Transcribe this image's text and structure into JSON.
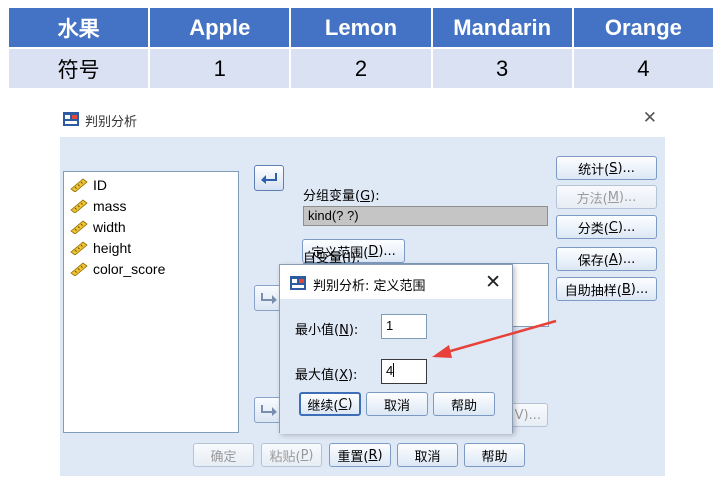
{
  "fruit_table": {
    "headers": [
      "水果",
      "Apple",
      "Lemon",
      "Mandarin",
      "Orange"
    ],
    "values": [
      "符号",
      "1",
      "2",
      "3",
      "4"
    ]
  },
  "main_dialog": {
    "title": "判别分析",
    "close_glyph": "✕",
    "variables": [
      "ID",
      "mass",
      "width",
      "height",
      "color_score"
    ],
    "grouping_label_text": "分组变量(",
    "grouping_label_key": "G",
    "grouping_label_end": "):",
    "grouping_value": "kind(? ?)",
    "define_range_text": "定义范围(",
    "define_range_key": "D",
    "define_range_end": ")...",
    "independents_label_text": "自变量(",
    "independents_label_key": "I",
    "independents_label_end": "):",
    "hidden_button_tail": "V)...",
    "right_buttons": [
      {
        "text": "统计(",
        "key": "S",
        "end": ")..."
      },
      {
        "text": "方法(",
        "key": "M",
        "end": ")..."
      },
      {
        "text": "分类(",
        "key": "C",
        "end": ")..."
      },
      {
        "text": "保存(",
        "key": "A",
        "end": ")..."
      },
      {
        "text": "自助抽样(",
        "key": "B",
        "end": ")..."
      }
    ],
    "bottom_buttons": [
      {
        "text": "确定",
        "key": "",
        "end": ""
      },
      {
        "text": "粘贴(",
        "key": "P",
        "end": ")"
      },
      {
        "text": "重置(",
        "key": "R",
        "end": ")"
      },
      {
        "text": "取消",
        "key": "",
        "end": ""
      },
      {
        "text": "帮助",
        "key": "",
        "end": ""
      }
    ]
  },
  "sub_dialog": {
    "title": "判别分析: 定义范围",
    "close_glyph": "✕",
    "min_label_text": "最小值(",
    "min_label_key": "N",
    "min_label_end": "):",
    "min_value": "1",
    "max_label_text": "最大值(",
    "max_label_key": "X",
    "max_label_end": "):",
    "max_value": "4",
    "continue_text": "继续(",
    "continue_key": "C",
    "continue_end": ")",
    "cancel": "取消",
    "help": "帮助"
  },
  "colors": {
    "table_header": "#4472c4",
    "table_row": "#d9e1f2",
    "dialog_bg": "#dfe8f5",
    "annotation_arrow": "#e8413a"
  }
}
